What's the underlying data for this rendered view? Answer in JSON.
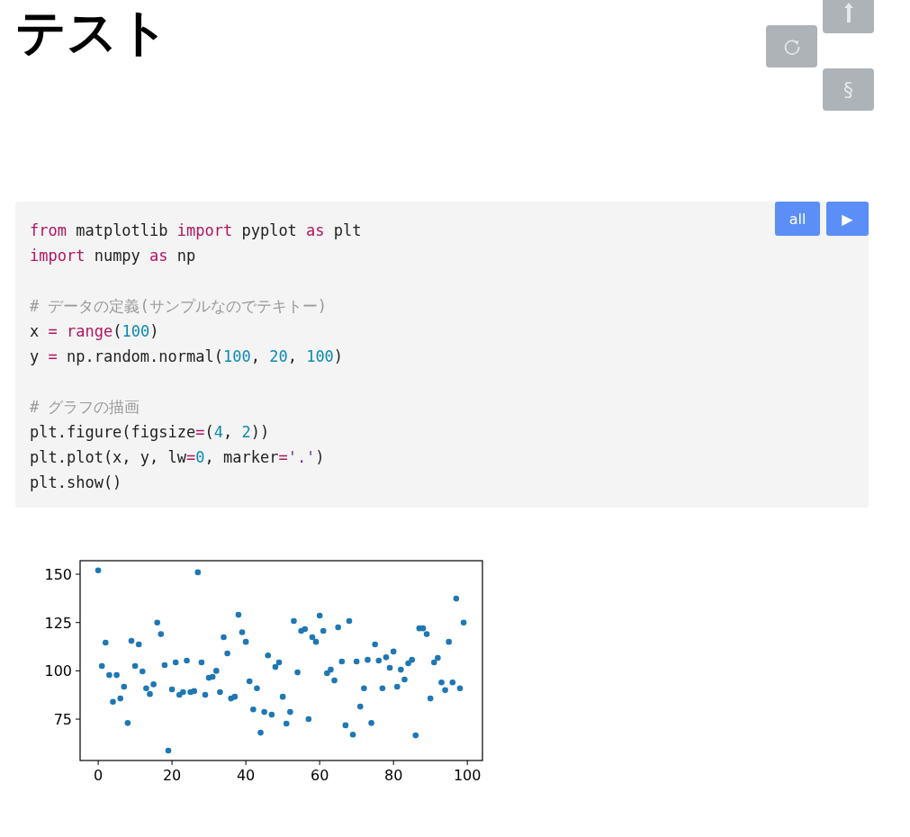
{
  "title": "テスト",
  "side_buttons": [
    {
      "kind": "top"
    },
    {
      "kind": "reload"
    },
    {
      "kind": "section",
      "label": "§"
    }
  ],
  "code_cell": {
    "run_all_label": "all",
    "run_label": "▶",
    "blocks": [
      [
        [
          {
            "text": "from",
            "kind": "keyword"
          },
          {
            "text": " matplotlib ",
            "kind": "plain"
          },
          {
            "text": "import",
            "kind": "keyword"
          },
          {
            "text": " pyplot ",
            "kind": "plain"
          },
          {
            "text": "as",
            "kind": "keyword"
          },
          {
            "text": " plt",
            "kind": "plain"
          }
        ],
        [
          {
            "text": "import",
            "kind": "keyword"
          },
          {
            "text": " numpy ",
            "kind": "plain"
          },
          {
            "text": "as",
            "kind": "keyword"
          },
          {
            "text": " np",
            "kind": "plain"
          }
        ]
      ],
      [
        [
          {
            "text": "# データの定義(サンプルなのでテキトー)",
            "kind": "comment"
          }
        ],
        [
          {
            "text": "x ",
            "kind": "plain"
          },
          {
            "text": "=",
            "kind": "keyword"
          },
          {
            "text": " range",
            "kind": "keyword"
          },
          {
            "text": "(",
            "kind": "plain"
          },
          {
            "text": "100",
            "kind": "number"
          },
          {
            "text": ")",
            "kind": "plain"
          }
        ],
        [
          {
            "text": "y ",
            "kind": "plain"
          },
          {
            "text": "=",
            "kind": "keyword"
          },
          {
            "text": " np.random.normal(",
            "kind": "plain"
          },
          {
            "text": "100",
            "kind": "number"
          },
          {
            "text": ", ",
            "kind": "plain"
          },
          {
            "text": "20",
            "kind": "number"
          },
          {
            "text": ", ",
            "kind": "plain"
          },
          {
            "text": "100",
            "kind": "number"
          },
          {
            "text": ")",
            "kind": "plain"
          }
        ]
      ],
      [
        [
          {
            "text": "# グラフの描画",
            "kind": "comment"
          }
        ],
        [
          {
            "text": "plt.figure(figsize",
            "kind": "plain"
          },
          {
            "text": "=",
            "kind": "keyword"
          },
          {
            "text": "(",
            "kind": "plain"
          },
          {
            "text": "4",
            "kind": "number"
          },
          {
            "text": ", ",
            "kind": "plain"
          },
          {
            "text": "2",
            "kind": "number"
          },
          {
            "text": "))",
            "kind": "plain"
          }
        ],
        [
          {
            "text": "plt.plot(x, y, lw",
            "kind": "plain"
          },
          {
            "text": "=",
            "kind": "keyword"
          },
          {
            "text": "0",
            "kind": "number"
          },
          {
            "text": ", marker",
            "kind": "plain"
          },
          {
            "text": "=",
            "kind": "keyword"
          },
          {
            "text": "'.'",
            "kind": "string"
          },
          {
            "text": ")",
            "kind": "plain"
          }
        ],
        [
          {
            "text": "plt.show()",
            "kind": "plain"
          }
        ]
      ]
    ]
  },
  "output": {
    "chart_data": {
      "type": "scatter",
      "x": [
        0,
        1,
        2,
        3,
        4,
        5,
        6,
        7,
        8,
        9,
        10,
        11,
        12,
        13,
        14,
        15,
        16,
        17,
        18,
        19,
        20,
        21,
        22,
        23,
        24,
        25,
        26,
        27,
        28,
        29,
        30,
        31,
        32,
        33,
        34,
        35,
        36,
        37,
        38,
        39,
        40,
        41,
        42,
        43,
        44,
        45,
        46,
        47,
        48,
        49,
        50,
        51,
        52,
        53,
        54,
        55,
        56,
        57,
        58,
        59,
        60,
        61,
        62,
        63,
        64,
        65,
        66,
        67,
        68,
        69,
        70,
        71,
        72,
        73,
        74,
        75,
        76,
        77,
        78,
        79,
        80,
        81,
        82,
        83,
        84,
        85,
        86,
        87,
        88,
        89,
        90,
        91,
        92,
        93,
        94,
        95,
        96,
        97,
        98,
        99
      ],
      "series": [
        {
          "color": "#1f77b4",
          "values": [
            152,
            102.5,
            114.6,
            97.8,
            84,
            97.8,
            85.7,
            91.8,
            73,
            115.5,
            102.5,
            113.7,
            99.7,
            91,
            88,
            93,
            125,
            119,
            103,
            58.7,
            90.4,
            104.4,
            87.6,
            89,
            105.3,
            89,
            89.5,
            151,
            104.4,
            87.6,
            96.4,
            96.9,
            100,
            89,
            117.4,
            109,
            85.7,
            86.6,
            129,
            120,
            115,
            94.6,
            80,
            91,
            68,
            78.7,
            108,
            77.3,
            102,
            104.4,
            86.6,
            72.7,
            78.7,
            125.8,
            99.2,
            120.7,
            121.6,
            75,
            117.4,
            115,
            128.6,
            120.7,
            98.8,
            100.6,
            95,
            122.5,
            104.8,
            71.8,
            125.8,
            67,
            104.8,
            81.5,
            91,
            105.7,
            73,
            113.7,
            105.3,
            91,
            107,
            101.6,
            110,
            91.8,
            100.6,
            95.5,
            103.9,
            105.7,
            66.6,
            122,
            122,
            119,
            85.7,
            104.4,
            106.7,
            94,
            90,
            115,
            94,
            137.4,
            91,
            125
          ]
        }
      ],
      "xlim": [
        -4.9,
        104.1
      ],
      "ylim": [
        53.6,
        157
      ],
      "xticks": [
        0,
        20,
        40,
        60,
        80,
        100
      ],
      "yticks": [
        75,
        100,
        125,
        150
      ]
    }
  }
}
